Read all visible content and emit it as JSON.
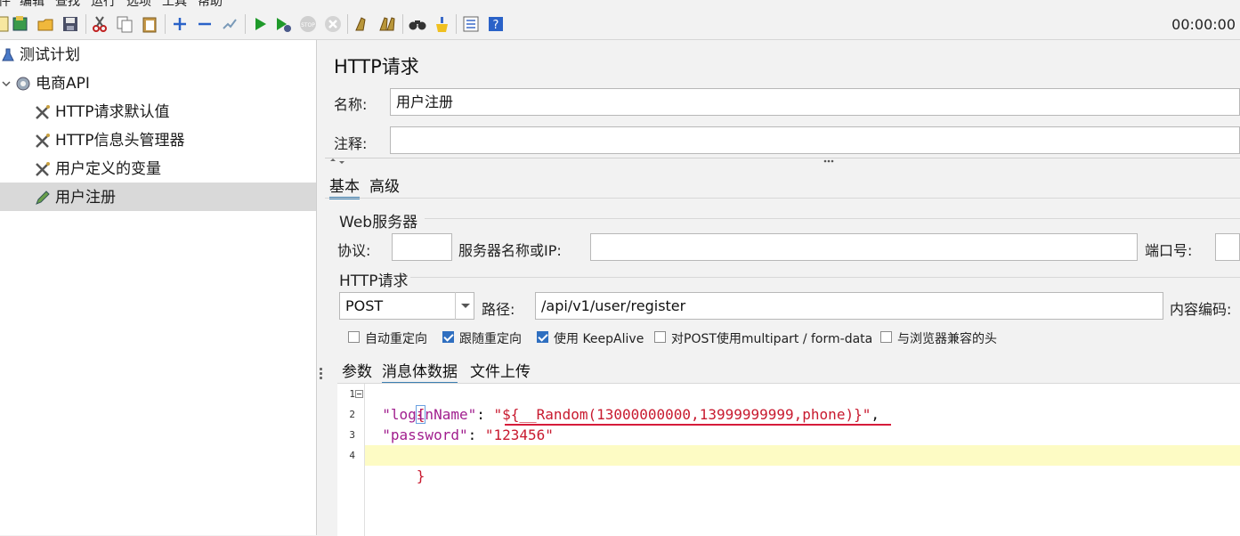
{
  "menu_bar": {
    "items": [
      "件",
      "编辑",
      "查找",
      "运行",
      "选项",
      "工具",
      "帮助"
    ]
  },
  "toolbar": {
    "timer": "00:00:00",
    "icons": [
      "new-icon",
      "templates-icon",
      "open-icon",
      "save-icon",
      "cut-icon",
      "copy-icon",
      "paste-icon",
      "expand-icon",
      "collapse-icon",
      "toggle-icon",
      "start-icon",
      "start-no-pause-icon",
      "stop-icon",
      "shutdown-icon",
      "clear-icon",
      "clear-all-icon",
      "search-icon",
      "reset-search-icon",
      "function-helper-icon",
      "help-icon"
    ]
  },
  "tree": {
    "nodes": [
      {
        "label": "测试计划",
        "icon": "test-plan-icon"
      },
      {
        "label": "电商API",
        "icon": "thread-group-icon"
      },
      {
        "label": "HTTP请求默认值",
        "icon": "config-element-icon"
      },
      {
        "label": "HTTP信息头管理器",
        "icon": "config-element-icon"
      },
      {
        "label": "用户定义的变量",
        "icon": "config-element-icon"
      },
      {
        "label": "用户注册",
        "icon": "sampler-pencil-icon",
        "selected": true
      }
    ]
  },
  "panel": {
    "title": "HTTP请求",
    "name_label": "名称:",
    "name_value": "用户注册",
    "comment_label": "注释:",
    "comment_value": "",
    "tabs": [
      "基本",
      "高级"
    ],
    "active_tab": "基本",
    "web_server": {
      "group_title": "Web服务器",
      "protocol_label": "协议:",
      "protocol_value": "",
      "server_label": "服务器名称或IP:",
      "server_value": "",
      "port_label": "端口号:",
      "port_value": ""
    },
    "http_request": {
      "group_title": "HTTP请求",
      "method": "POST",
      "path_label": "路径:",
      "path_value": "/api/v1/user/register",
      "encoding_label": "内容编码:"
    },
    "options": [
      {
        "label": "自动重定向",
        "checked": false
      },
      {
        "label": "跟随重定向",
        "checked": true
      },
      {
        "label": "使用 KeepAlive",
        "checked": true
      },
      {
        "label": "对POST使用multipart / form-data",
        "checked": false
      },
      {
        "label": "与浏览器兼容的头",
        "checked": false
      }
    ],
    "sub_tabs": [
      "参数",
      "消息体数据",
      "文件上传"
    ],
    "active_sub_tab": "消息体数据"
  },
  "editor": {
    "line_numbers": [
      "1",
      "2",
      "3",
      "4"
    ],
    "open_brace": "{",
    "close_brace": "}",
    "line2_key": "\"loginName\"",
    "line2_colon": ": ",
    "line2_value": "\"${__Random(13000000000,13999999999,phone)}\"",
    "line2_comma": ",",
    "line3_key": "\"password\"",
    "line3_colon": ": ",
    "line3_value": "\"123456\"",
    "highlight_color": "#fdfbc4",
    "underline_color": "#d61c3a"
  }
}
